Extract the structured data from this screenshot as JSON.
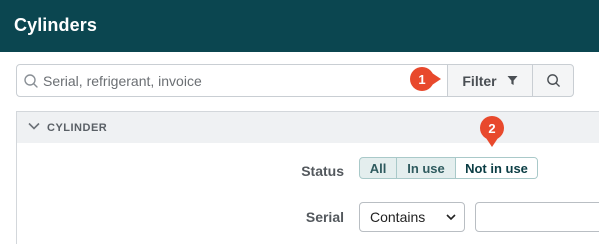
{
  "header": {
    "title": "Cylinders"
  },
  "search": {
    "placeholder": "Serial, refrigerant, invoice",
    "value": ""
  },
  "toolbar": {
    "filter_label": "Filter"
  },
  "section": {
    "title": "CYLINDER"
  },
  "status": {
    "label": "Status",
    "options": [
      "All",
      "In use",
      "Not in use"
    ],
    "selected": "Not in use"
  },
  "serial": {
    "label": "Serial",
    "operator": "Contains",
    "value": ""
  },
  "callouts": [
    "1",
    "2"
  ],
  "colors": {
    "header_bg": "#0b4650",
    "callout": "#e8492c",
    "segment_bg": "#e4eeee"
  }
}
